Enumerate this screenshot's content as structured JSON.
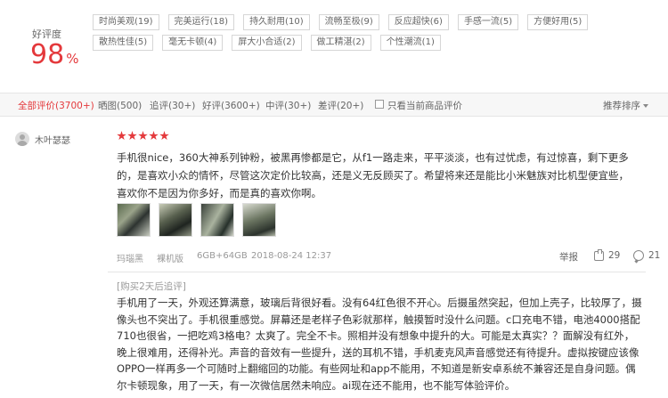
{
  "summary": {
    "rate_label": "好评度",
    "rate_value": "98",
    "rate_unit": "%",
    "tags": [
      "时尚美观(19)",
      "完美运行(18)",
      "持久耐用(10)",
      "流畅至极(9)",
      "反应超快(6)",
      "手感一流(5)",
      "方便好用(5)",
      "散热性佳(5)",
      "毫无卡顿(4)",
      "屏大小合适(2)",
      "做工精湛(2)",
      "个性潮流(1)"
    ]
  },
  "filters": {
    "all": "全部评价(3700+)",
    "photo": "晒图(500)",
    "append": "追评(30+)",
    "good": "好评(3600+)",
    "medium": "中评(30+)",
    "bad": "差评(20+)",
    "current_only": "只看当前商品评价",
    "sort": "推荐排序"
  },
  "review": {
    "username": "木叶瑟瑟",
    "stars": 5,
    "content": "手机用了一天，外观还算满意，玻璃后背很好看。没有64红色很不开心。后摄虽然突起，但加上壳子，比较厚了，摄像头也不突出了。手机很重感觉。屏幕还是老样子色彩就那样，触摸暂时没什么问题。c口充电不错，电池4000搭配710也很省，一把吃鸡3格电？太爽了。完全不卡。照相并没有想象中提升的大。可能是太真实？？面解没有红外，晚上很难用，还得补光。声音的音效有一些提升，送的耳机不错，手机麦克风声音感觉还有待提升。虚拟按键应该像OPPO一样再多一个可随时上翻缩回的功能。有些网址和app不能用，不知道是新安卓系统不兼容还是自身问题。偶尔卡顿现象，用了一天，有一次微信居然未响应。ai现在还不能用，也不能写体验评价。",
    "content_main": "手机很nice，360大神系列钟粉，被黑再惨都是它，从f1一路走来，平平淡淡，也有过忧虑，有过惊喜，剩下更多的，是喜欢小众的情怀，尽管这次定价比较高，还是义无反顾买了。希望将来还是能比小米魅族对比机型便宜些，喜欢你不是因为你多好，而是真的喜欢你啊。",
    "color": "玛瑙黑",
    "version": "裸机版",
    "spec": "6GB+64GB",
    "date": "2018-08-24 12:37",
    "report": "举报",
    "likes": "29",
    "comments": "21",
    "append_label": "[购买2天后追评]",
    "thumb_count": 4
  },
  "colors": {
    "accent": "#e4393c"
  }
}
